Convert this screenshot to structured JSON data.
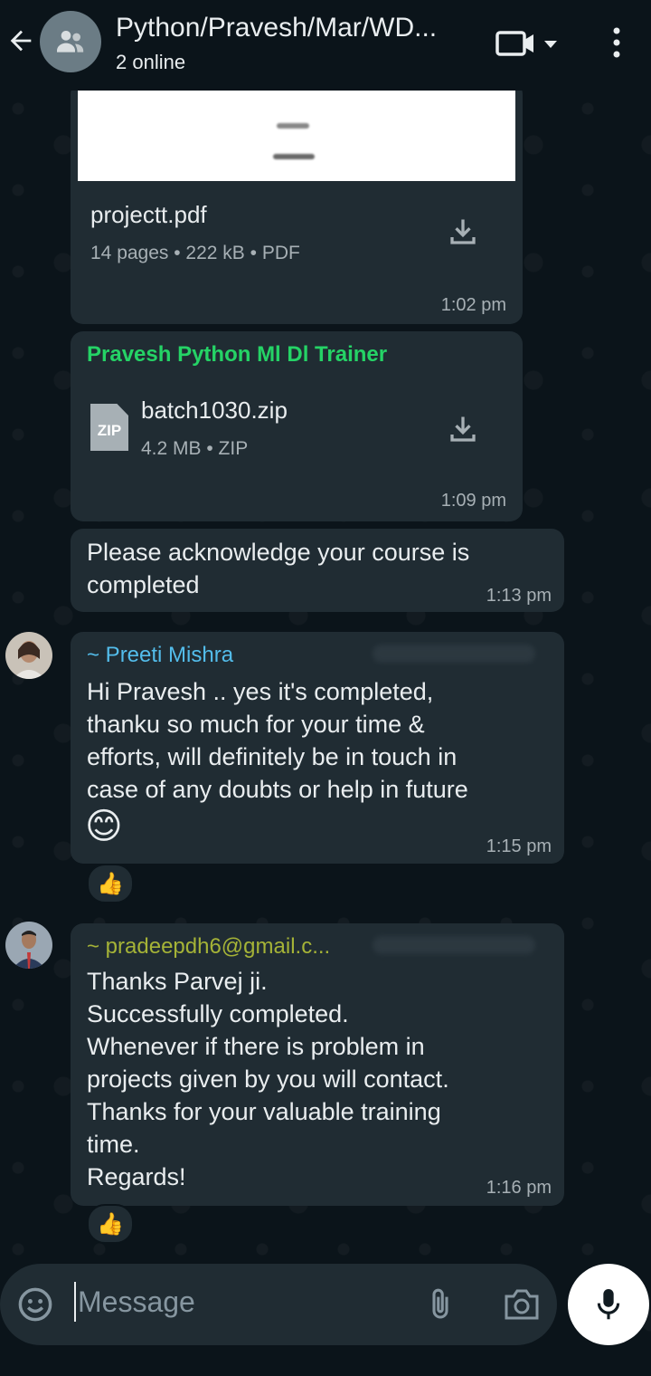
{
  "header": {
    "title": "Python/Pravesh/Mar/WD...",
    "subtitle": "2 online"
  },
  "messages": {
    "pdf": {
      "file_name": "projectt.pdf",
      "meta": "14 pages • 222 kB • PDF",
      "time": "1:02 pm"
    },
    "zip": {
      "sender": "Pravesh Python Ml Dl Trainer",
      "file_name": "batch1030.zip",
      "meta": "4.2 MB • ZIP",
      "icon_label": "ZIP",
      "time": "1:09 pm"
    },
    "ack": {
      "text": "Please acknowledge your course is\ncompleted",
      "time": "1:13 pm"
    },
    "preeti": {
      "sender": "~ Preeti Mishra",
      "text": "Hi Pravesh .. yes it's completed,\nthanku so much for your time &\nefforts, will definitely be in touch in\ncase of any doubts or help in future",
      "emoji": "😊",
      "time": "1:15 pm",
      "reaction": "👍"
    },
    "pradeep": {
      "sender": "~ pradeepdh6@gmail.c...",
      "text": "Thanks Parvej ji.\nSuccessfully completed.\nWhenever if there is problem in\nprojects given by you will contact.\nThanks for your valuable training\ntime.\nRegards!",
      "time": "1:16 pm",
      "reaction": "👍"
    }
  },
  "input": {
    "placeholder": "Message"
  },
  "colors": {
    "background": "#0b141a",
    "bubble": "#202c33",
    "sender_zip": "#25d366",
    "sender_preeti": "#53bdeb",
    "sender_pradeep": "#a5b337"
  }
}
